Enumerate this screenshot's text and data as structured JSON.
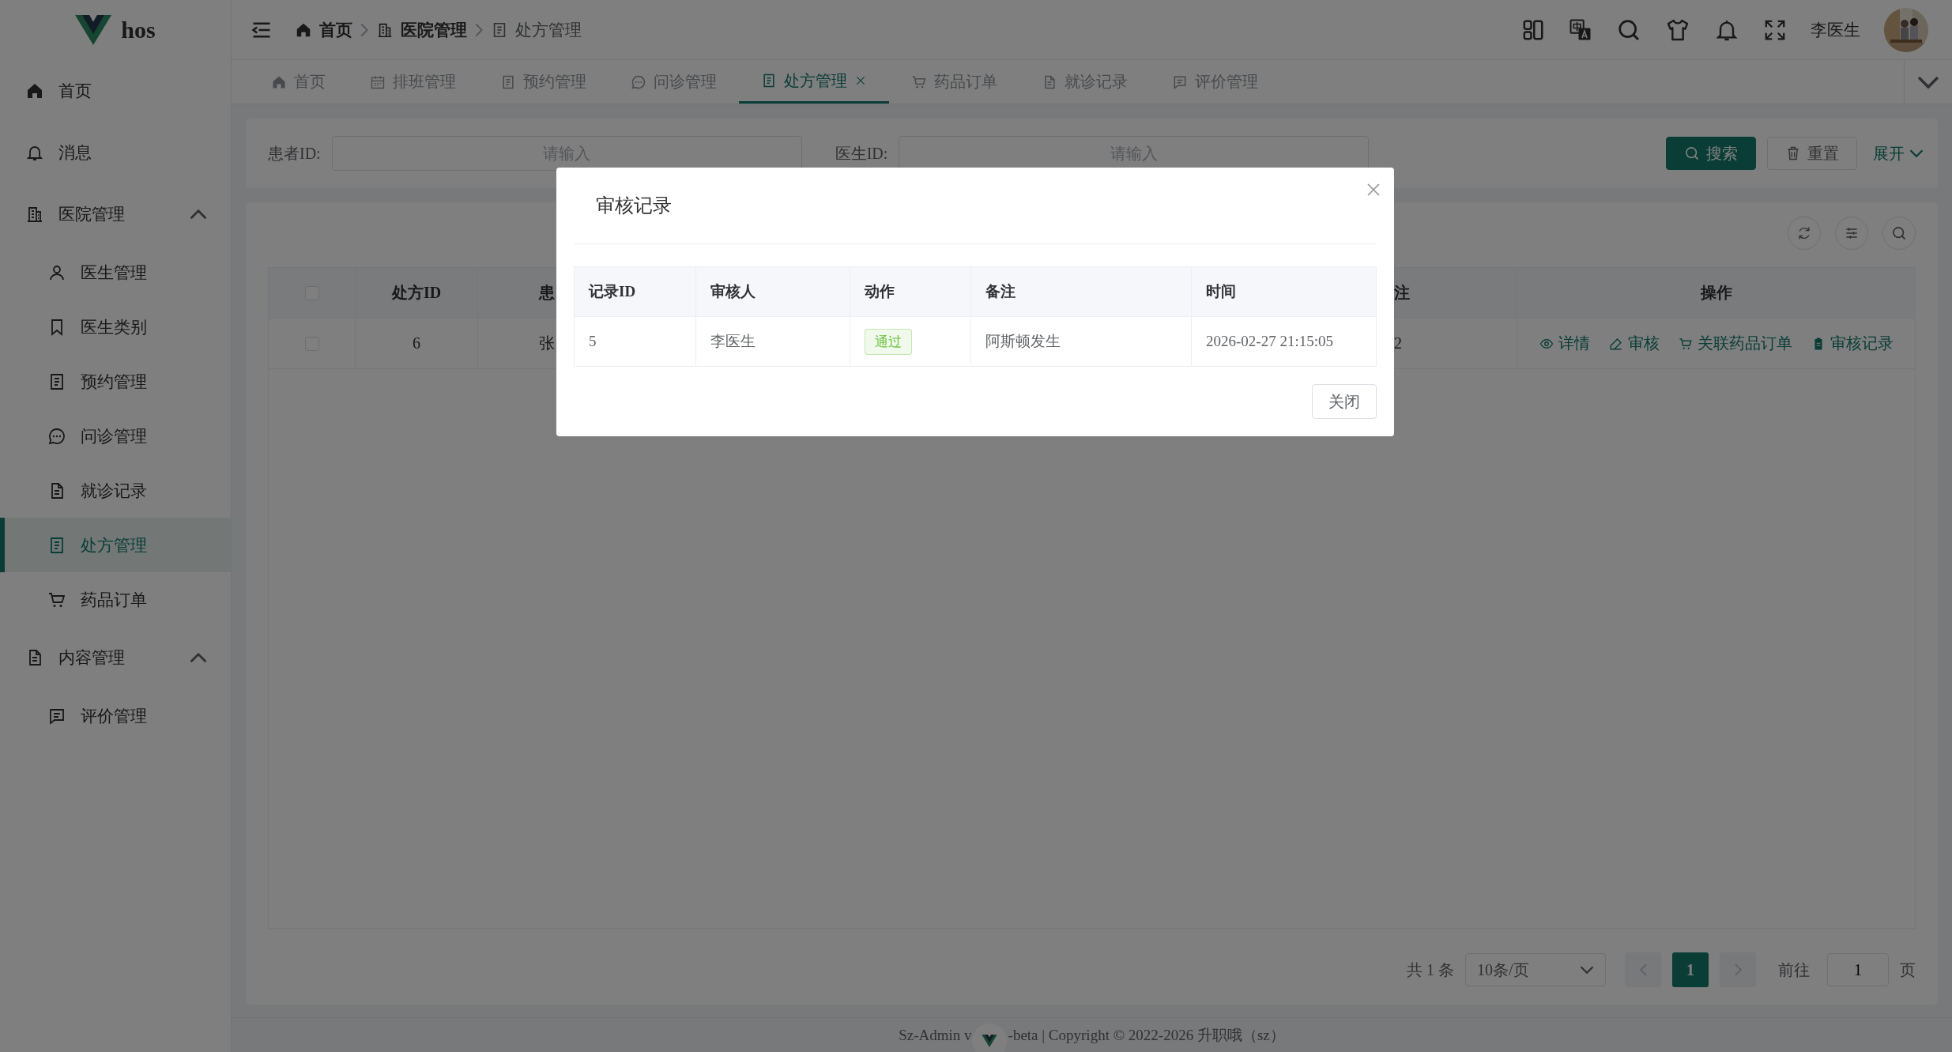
{
  "sidebar": {
    "logo_text": "hos",
    "items": [
      {
        "label": "首页",
        "selected": false
      },
      {
        "label": "消息",
        "selected": false
      },
      {
        "label": "医院管理",
        "selected": false,
        "expanded": true,
        "children": [
          {
            "label": "医生管理",
            "selected": false
          },
          {
            "label": "医生类别",
            "selected": false
          },
          {
            "label": "预约管理",
            "selected": false
          },
          {
            "label": "问诊管理",
            "selected": false
          },
          {
            "label": "就诊记录",
            "selected": false
          },
          {
            "label": "处方管理",
            "selected": true
          },
          {
            "label": "药品订单",
            "selected": false
          }
        ]
      },
      {
        "label": "内容管理",
        "selected": false,
        "expanded": true,
        "children": [
          {
            "label": "评价管理",
            "selected": false
          }
        ]
      }
    ]
  },
  "header": {
    "breadcrumb": [
      "首页",
      "医院管理",
      "处方管理"
    ],
    "user_name": "李医生"
  },
  "tabs": [
    {
      "label": "首页",
      "selected": false
    },
    {
      "label": "排班管理",
      "selected": false
    },
    {
      "label": "预约管理",
      "selected": false
    },
    {
      "label": "问诊管理",
      "selected": false
    },
    {
      "label": "处方管理",
      "selected": true
    },
    {
      "label": "药品订单",
      "selected": false
    },
    {
      "label": "就诊记录",
      "selected": false
    },
    {
      "label": "评价管理",
      "selected": false
    }
  ],
  "search": {
    "fields": [
      {
        "label": "患者ID:",
        "placeholder": "请输入"
      },
      {
        "label": "医生ID:",
        "placeholder": "请输入"
      }
    ],
    "search_button": "搜索",
    "reset_button": "重置",
    "expand_link": "展开"
  },
  "table": {
    "header_checked": false,
    "columns": [
      "处方ID",
      "患",
      "注",
      "操作"
    ],
    "rows": [
      {
        "checked": false,
        "cells": [
          "6",
          "张",
          "2"
        ],
        "actions": [
          "详情",
          "审核",
          "关联药品订单",
          "审核记录"
        ]
      }
    ]
  },
  "pagination": {
    "total": "共 1 条",
    "page_size": "10条/页",
    "pages": [
      {
        "label": "1",
        "selected": true
      }
    ],
    "goto_label": "前往",
    "goto_value": "1",
    "page_suffix": "页"
  },
  "footer": {
    "text_before": "Sz-Admin v",
    "text_after": "-beta | Copyright © 2022-2026 升职哦（sz）"
  },
  "modal": {
    "title": "审核记录",
    "columns": [
      "记录ID",
      "审核人",
      "动作",
      "备注",
      "时间"
    ],
    "rows": [
      {
        "record_id": "5",
        "reviewer": "李医生",
        "action": {
          "label": "通过",
          "color": "#67c23a"
        },
        "remark": "阿斯顿发生",
        "time": "2026-02-27 21:15:05"
      }
    ],
    "close_button": "关闭"
  }
}
